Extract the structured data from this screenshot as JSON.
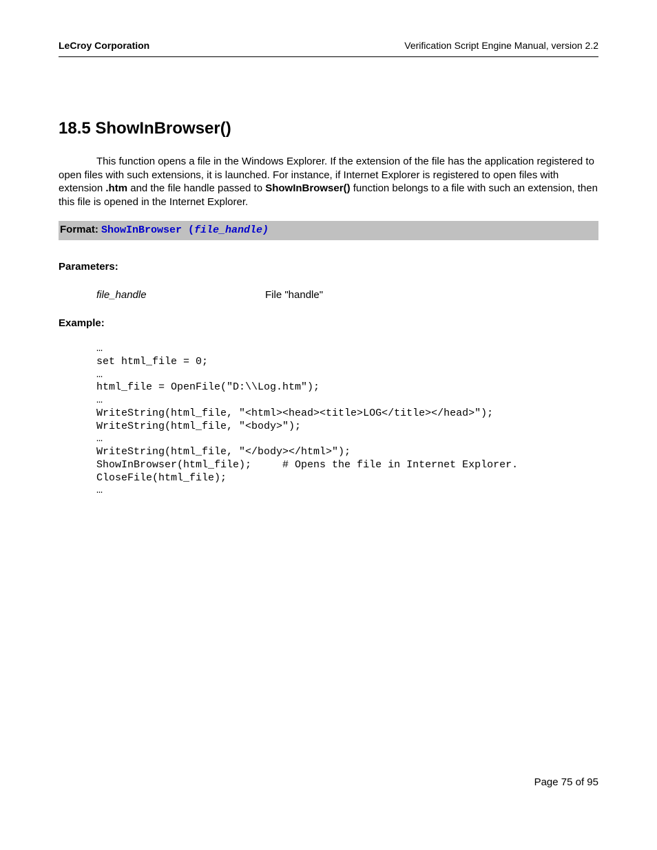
{
  "header": {
    "left": "LeCroy Corporation",
    "right": "Verification Script Engine Manual, version 2.2"
  },
  "section": {
    "title": "18.5  ShowInBrowser()",
    "body_pre": "This function opens a file in the Windows Explorer. If the extension of the file has the application registered to open files with such extensions, it is launched. For instance, if Internet Explorer is registered to open files with extension ",
    "body_bold1": ".htm",
    "body_mid": " and the file handle passed to ",
    "body_bold2": "ShowInBrowser()",
    "body_post": " function belongs to a file with such an extension, then this file is opened in the Internet Explorer."
  },
  "format": {
    "label": "Format: ",
    "code": "ShowInBrowser (",
    "arg": "file_handle)"
  },
  "parameters": {
    "heading": "Parameters:",
    "name": "file_handle",
    "desc": "File \"handle\""
  },
  "example": {
    "heading": "Example:",
    "code": "…\nset html_file = 0;\n…\nhtml_file = OpenFile(\"D:\\\\Log.htm\");\n…\nWriteString(html_file, \"<html><head><title>LOG</title></head>\");\nWriteString(html_file, \"<body>\");\n…\nWriteString(html_file, \"</body></html>\");\nShowInBrowser(html_file);     # Opens the file in Internet Explorer.\nCloseFile(html_file);\n…"
  },
  "footer": "Page 75 of 95"
}
